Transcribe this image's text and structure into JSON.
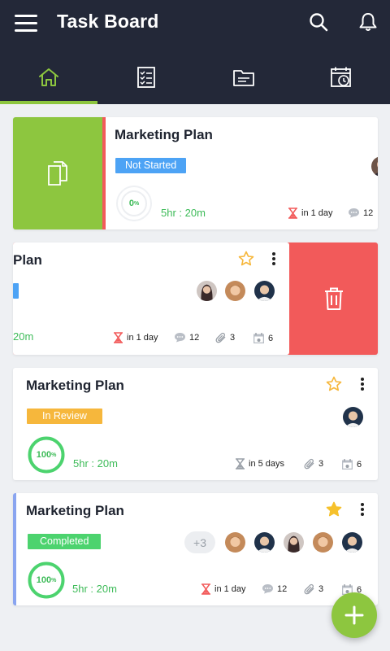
{
  "app": {
    "title": "Task Board"
  },
  "tabs": [
    {
      "name": "home",
      "icon": "home-icon",
      "active": true
    },
    {
      "name": "checklist",
      "icon": "checklist-icon",
      "active": false
    },
    {
      "name": "files",
      "icon": "folder-icon",
      "active": false
    },
    {
      "name": "calendar",
      "icon": "calendar-clock-icon",
      "active": false
    }
  ],
  "colors": {
    "appbar": "#232838",
    "accent": "#8dc63f",
    "danger": "#f25a5a",
    "not_started": "#4da3f5",
    "in_review": "#f6b73c",
    "completed": "#4cd36e",
    "progress_green": "#3dbb58"
  },
  "cards": [
    {
      "title": "Marketing Plan",
      "status": "Not Started",
      "progress": "0",
      "progress_fraction": 0,
      "time": "5hr : 20m",
      "due": "in 1 day",
      "comments": "12",
      "swipe_action": "duplicate-icon",
      "state": "swiped-right"
    },
    {
      "title": "Plan",
      "time": "20m",
      "due": "in 1 day",
      "comments": "12",
      "attachments": "3",
      "events": "6",
      "starred": false,
      "swipe_action": "trash-icon",
      "state": "swiped-left"
    },
    {
      "title": "Marketing Plan",
      "status": "In Review",
      "progress": "100",
      "progress_fraction": 1,
      "time": "5hr : 20m",
      "due": "in 5 days",
      "attachments": "3",
      "events": "6",
      "starred": false
    },
    {
      "title": "Marketing Plan",
      "status": "Completed",
      "progress": "100",
      "progress_fraction": 1,
      "time": "5hr : 20m",
      "due": "in 1 day",
      "comments": "12",
      "attachments": "3",
      "events": "6",
      "starred": true,
      "more_members": "+3"
    }
  ],
  "fab": {
    "icon": "plus-icon"
  }
}
